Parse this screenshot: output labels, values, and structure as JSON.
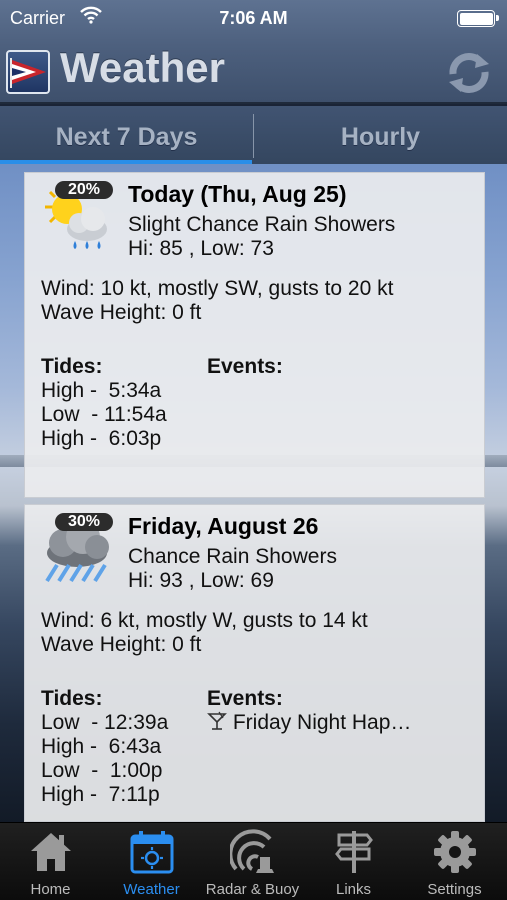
{
  "status_bar": {
    "carrier": "Carrier",
    "time": "7:06 AM"
  },
  "header": {
    "title": "Weather",
    "refresh_icon": "refresh-icon"
  },
  "segments": [
    {
      "label": "Next 7 Days",
      "selected": true
    },
    {
      "label": "Hourly",
      "selected": false
    }
  ],
  "forecast": [
    {
      "precip_chance": "20%",
      "icon": "sun-cloud-rain-icon",
      "day": "Today (Thu, Aug 25)",
      "condition": "Slight Chance Rain Showers",
      "hilo": "Hi: 85 , Low: 73",
      "wind": "Wind: 10 kt,  mostly  SW, gusts to 20 kt",
      "wave": "Wave Height: 0 ft",
      "tides_label": "Tides:",
      "events_label": "Events:",
      "tides": [
        "High -  5:34a",
        "Low  - 11:54a",
        "High -  6:03p"
      ],
      "events": []
    },
    {
      "precip_chance": "30%",
      "icon": "cloud-rain-icon",
      "day": "Friday, August 26",
      "condition": "Chance Rain Showers",
      "hilo": "Hi: 93 , Low: 69",
      "wind": "Wind: 6 kt,  mostly  W, gusts to 14 kt",
      "wave": "Wave Height: 0 ft",
      "tides_label": "Tides:",
      "events_label": "Events:",
      "tides": [
        "Low  - 12:39a",
        "High -  6:43a",
        "Low  -  1:00p",
        "High -  7:11p"
      ],
      "events": [
        {
          "icon": "cocktail-icon",
          "text": "Friday Night Hap…"
        }
      ]
    }
  ],
  "tabbar": [
    {
      "label": "Home",
      "icon": "home-icon",
      "active": false
    },
    {
      "label": "Weather",
      "icon": "weather-calendar-icon",
      "active": true
    },
    {
      "label": "Radar & Buoy",
      "icon": "radar-icon",
      "active": false
    },
    {
      "label": "Links",
      "icon": "signpost-icon",
      "active": false
    },
    {
      "label": "Settings",
      "icon": "gear-icon",
      "active": false
    }
  ],
  "colors": {
    "accent": "#2b8ef0",
    "header": "#4d607e"
  }
}
